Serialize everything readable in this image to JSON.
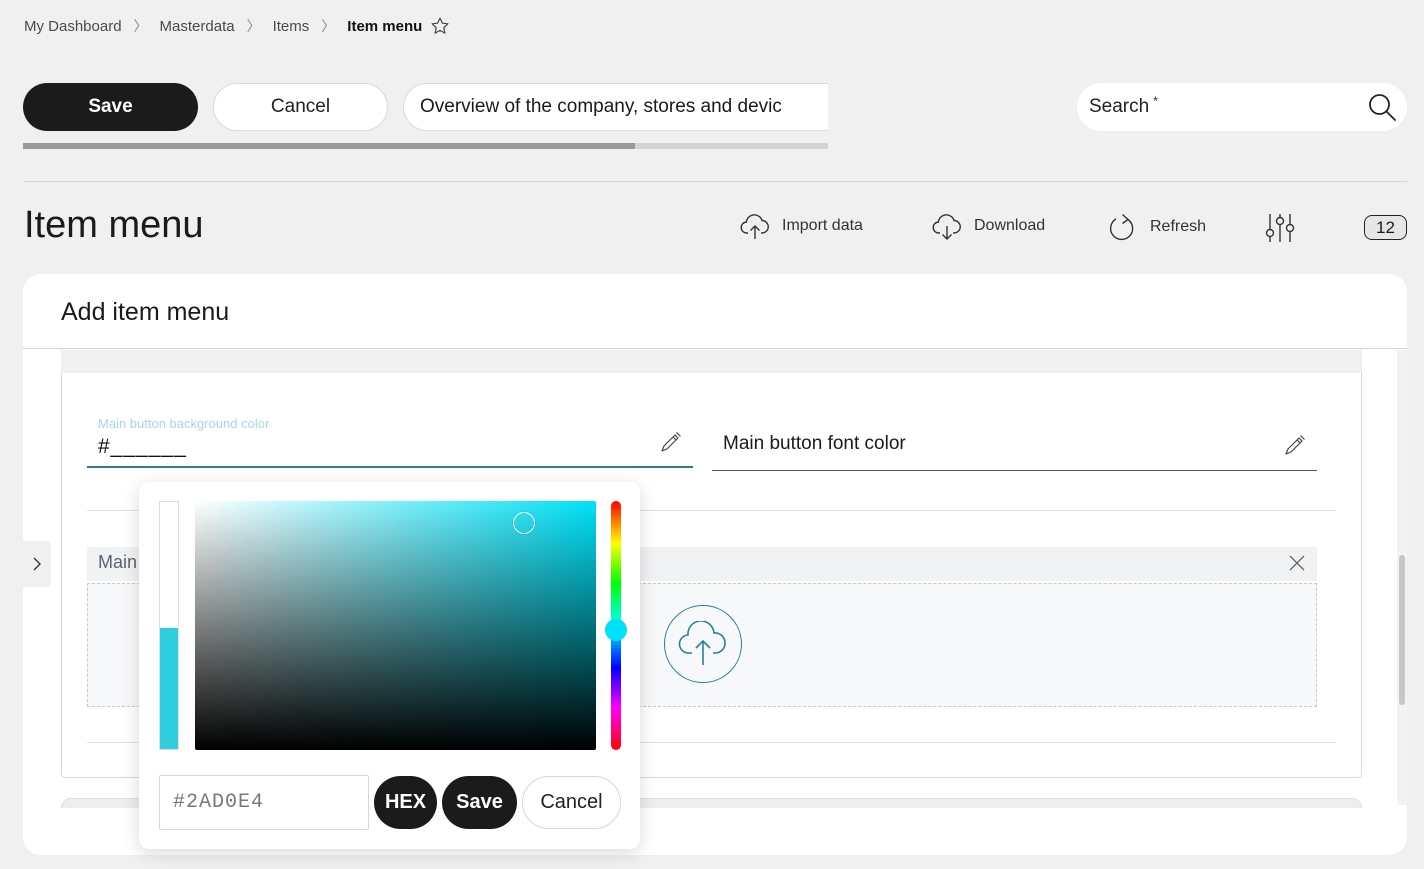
{
  "breadcrumb": {
    "items": [
      "My Dashboard",
      "Masterdata",
      "Items"
    ],
    "current": "Item menu"
  },
  "actions": {
    "save_label": "Save",
    "cancel_label": "Cancel",
    "description": "Overview of the company, stores and devic",
    "progress": 0.76
  },
  "search": {
    "label": "Search",
    "required_mark": "*"
  },
  "page": {
    "title": "Item menu"
  },
  "toolbar": {
    "import_label": "Import data",
    "download_label": "Download",
    "refresh_label": "Refresh",
    "badge_count": "12"
  },
  "card": {
    "title": "Add item menu"
  },
  "form": {
    "bg_color_label": "Main button background color",
    "bg_color_value": "#______",
    "font_color_label": "Main button font color",
    "upload_label": "Main"
  },
  "picker": {
    "hex_value": "#2AD0E4",
    "mode_label": "HEX",
    "save_label": "Save",
    "cancel_label": "Cancel",
    "selected_color": "#2AD0E4",
    "hue_color": "#00E1F7",
    "alpha_level": 0.49,
    "saturation": 0.82,
    "brightness": 0.91,
    "hue_position": 0.52
  },
  "colors": {
    "primary_dark": "#1B1B1B",
    "accent_teal": "#2A7F96"
  }
}
